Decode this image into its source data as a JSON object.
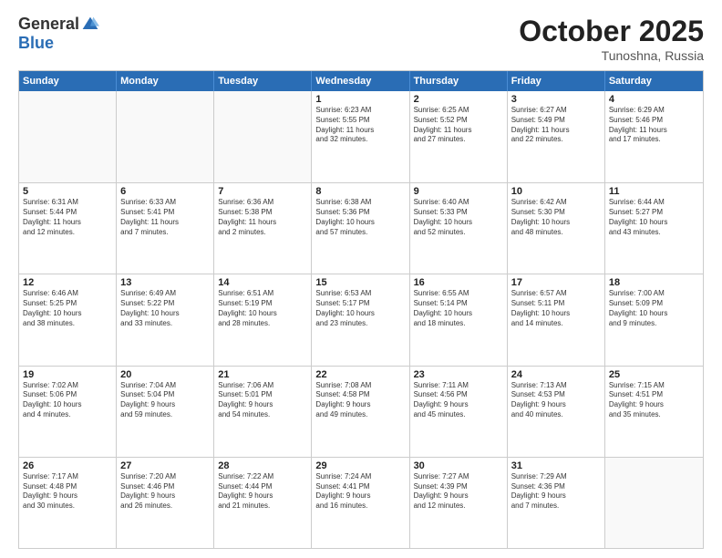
{
  "logo": {
    "general": "General",
    "blue": "Blue"
  },
  "title": "October 2025",
  "location": "Tunoshna, Russia",
  "header_days": [
    "Sunday",
    "Monday",
    "Tuesday",
    "Wednesday",
    "Thursday",
    "Friday",
    "Saturday"
  ],
  "weeks": [
    [
      {
        "day": "",
        "text": ""
      },
      {
        "day": "",
        "text": ""
      },
      {
        "day": "",
        "text": ""
      },
      {
        "day": "1",
        "text": "Sunrise: 6:23 AM\nSunset: 5:55 PM\nDaylight: 11 hours\nand 32 minutes."
      },
      {
        "day": "2",
        "text": "Sunrise: 6:25 AM\nSunset: 5:52 PM\nDaylight: 11 hours\nand 27 minutes."
      },
      {
        "day": "3",
        "text": "Sunrise: 6:27 AM\nSunset: 5:49 PM\nDaylight: 11 hours\nand 22 minutes."
      },
      {
        "day": "4",
        "text": "Sunrise: 6:29 AM\nSunset: 5:46 PM\nDaylight: 11 hours\nand 17 minutes."
      }
    ],
    [
      {
        "day": "5",
        "text": "Sunrise: 6:31 AM\nSunset: 5:44 PM\nDaylight: 11 hours\nand 12 minutes."
      },
      {
        "day": "6",
        "text": "Sunrise: 6:33 AM\nSunset: 5:41 PM\nDaylight: 11 hours\nand 7 minutes."
      },
      {
        "day": "7",
        "text": "Sunrise: 6:36 AM\nSunset: 5:38 PM\nDaylight: 11 hours\nand 2 minutes."
      },
      {
        "day": "8",
        "text": "Sunrise: 6:38 AM\nSunset: 5:36 PM\nDaylight: 10 hours\nand 57 minutes."
      },
      {
        "day": "9",
        "text": "Sunrise: 6:40 AM\nSunset: 5:33 PM\nDaylight: 10 hours\nand 52 minutes."
      },
      {
        "day": "10",
        "text": "Sunrise: 6:42 AM\nSunset: 5:30 PM\nDaylight: 10 hours\nand 48 minutes."
      },
      {
        "day": "11",
        "text": "Sunrise: 6:44 AM\nSunset: 5:27 PM\nDaylight: 10 hours\nand 43 minutes."
      }
    ],
    [
      {
        "day": "12",
        "text": "Sunrise: 6:46 AM\nSunset: 5:25 PM\nDaylight: 10 hours\nand 38 minutes."
      },
      {
        "day": "13",
        "text": "Sunrise: 6:49 AM\nSunset: 5:22 PM\nDaylight: 10 hours\nand 33 minutes."
      },
      {
        "day": "14",
        "text": "Sunrise: 6:51 AM\nSunset: 5:19 PM\nDaylight: 10 hours\nand 28 minutes."
      },
      {
        "day": "15",
        "text": "Sunrise: 6:53 AM\nSunset: 5:17 PM\nDaylight: 10 hours\nand 23 minutes."
      },
      {
        "day": "16",
        "text": "Sunrise: 6:55 AM\nSunset: 5:14 PM\nDaylight: 10 hours\nand 18 minutes."
      },
      {
        "day": "17",
        "text": "Sunrise: 6:57 AM\nSunset: 5:11 PM\nDaylight: 10 hours\nand 14 minutes."
      },
      {
        "day": "18",
        "text": "Sunrise: 7:00 AM\nSunset: 5:09 PM\nDaylight: 10 hours\nand 9 minutes."
      }
    ],
    [
      {
        "day": "19",
        "text": "Sunrise: 7:02 AM\nSunset: 5:06 PM\nDaylight: 10 hours\nand 4 minutes."
      },
      {
        "day": "20",
        "text": "Sunrise: 7:04 AM\nSunset: 5:04 PM\nDaylight: 9 hours\nand 59 minutes."
      },
      {
        "day": "21",
        "text": "Sunrise: 7:06 AM\nSunset: 5:01 PM\nDaylight: 9 hours\nand 54 minutes."
      },
      {
        "day": "22",
        "text": "Sunrise: 7:08 AM\nSunset: 4:58 PM\nDaylight: 9 hours\nand 49 minutes."
      },
      {
        "day": "23",
        "text": "Sunrise: 7:11 AM\nSunset: 4:56 PM\nDaylight: 9 hours\nand 45 minutes."
      },
      {
        "day": "24",
        "text": "Sunrise: 7:13 AM\nSunset: 4:53 PM\nDaylight: 9 hours\nand 40 minutes."
      },
      {
        "day": "25",
        "text": "Sunrise: 7:15 AM\nSunset: 4:51 PM\nDaylight: 9 hours\nand 35 minutes."
      }
    ],
    [
      {
        "day": "26",
        "text": "Sunrise: 7:17 AM\nSunset: 4:48 PM\nDaylight: 9 hours\nand 30 minutes."
      },
      {
        "day": "27",
        "text": "Sunrise: 7:20 AM\nSunset: 4:46 PM\nDaylight: 9 hours\nand 26 minutes."
      },
      {
        "day": "28",
        "text": "Sunrise: 7:22 AM\nSunset: 4:44 PM\nDaylight: 9 hours\nand 21 minutes."
      },
      {
        "day": "29",
        "text": "Sunrise: 7:24 AM\nSunset: 4:41 PM\nDaylight: 9 hours\nand 16 minutes."
      },
      {
        "day": "30",
        "text": "Sunrise: 7:27 AM\nSunset: 4:39 PM\nDaylight: 9 hours\nand 12 minutes."
      },
      {
        "day": "31",
        "text": "Sunrise: 7:29 AM\nSunset: 4:36 PM\nDaylight: 9 hours\nand 7 minutes."
      },
      {
        "day": "",
        "text": ""
      }
    ]
  ]
}
